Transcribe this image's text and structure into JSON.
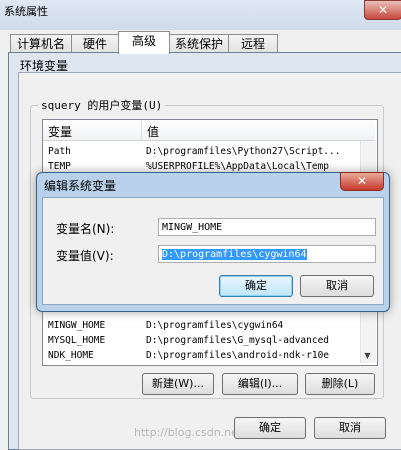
{
  "system_properties": {
    "title": "系统属性",
    "tabs": [
      {
        "label": "计算机名"
      },
      {
        "label": "硬件"
      },
      {
        "label": "高级"
      },
      {
        "label": "系统保护"
      },
      {
        "label": "远程"
      }
    ],
    "close_symbol": "✕"
  },
  "env_window": {
    "title": "环境变量",
    "user_group_title": "squery 的用户变量(U)",
    "columns": {
      "name": "变量",
      "value": "值"
    },
    "rows": [
      {
        "name": "Path",
        "value": "D:\\programfiles\\Python27\\Script..."
      },
      {
        "name": "TEMP",
        "value": "%USERPROFILE%\\AppData\\Local\\Temp"
      },
      {
        "name": "MINGW_HOME",
        "value": "D:\\programfiles\\cygwin64"
      },
      {
        "name": "MYSQL_HOME",
        "value": "D:\\programfiles\\G_mysql-advanced"
      },
      {
        "name": "NDK_HOME",
        "value": "D:\\programfiles\\android-ndk-r10e"
      }
    ],
    "buttons": {
      "new": "新建(W)...",
      "edit": "编辑(I)...",
      "delete": "删除(L)"
    },
    "ok": "确定",
    "cancel": "取消"
  },
  "edit_dialog": {
    "title": "编辑系统变量",
    "close_symbol": "✕",
    "name_label": "变量名(N):",
    "value_label": "变量值(V):",
    "name_value": "MINGW_HOME",
    "value_value": "D:\\programfiles\\cygwin64",
    "ok": "确定",
    "cancel": "取消"
  },
  "watermark": "http://blog.csdn.net/"
}
